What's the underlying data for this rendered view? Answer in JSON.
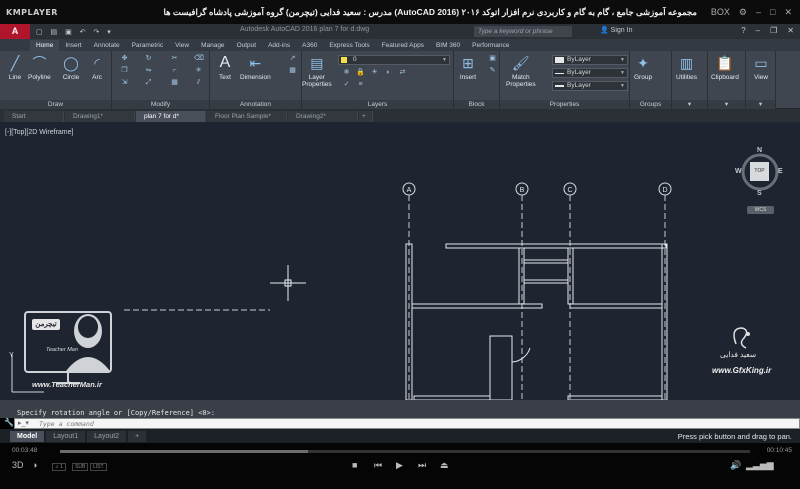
{
  "player": {
    "logo": "KMPLAYER",
    "title": "مجموعه آموزشی جامع ، گام به گام و کاربردی نرم افزار  اتوکد ۲۰۱۶ (AutoCAD 2016)  مدرس : سعید فدایی (تیچرمن) گروه آموزشی پادشاه گرافیست ها",
    "box_label": "BOX",
    "time_elapsed": "00:03:48",
    "time_total": "00:10:45",
    "progress": 0.36
  },
  "acad": {
    "logo": "A",
    "doc_title": "Autodesk AutoCAD 2016    plan 7 for d.dwg",
    "search_placeholder": "Type a keyword or phrase",
    "signin": "Sign In",
    "ribbon_tabs": [
      "Home",
      "Insert",
      "Annotate",
      "Parametric",
      "View",
      "Manage",
      "Output",
      "Add-ins",
      "A360",
      "Express Tools",
      "Featured Apps",
      "BIM 360",
      "Performance"
    ],
    "panels": {
      "draw": {
        "title": "Draw",
        "line": "Line",
        "polyline": "Polyline",
        "circle": "Circle",
        "arc": "Arc"
      },
      "modify": {
        "title": "Modify"
      },
      "annotation": {
        "title": "Annotation",
        "text": "Text",
        "dimension": "Dimension"
      },
      "layers": {
        "title": "Layers",
        "layer_properties": "Layer\nProperties",
        "current_layer": "0"
      },
      "block": {
        "title": "Block",
        "insert": "Insert"
      },
      "properties": {
        "title": "Properties",
        "match": "Match\nProperties",
        "color": "ByLayer",
        "linetype": "ByLayer",
        "lineweight": "ByLayer"
      },
      "groups": {
        "title": "Groups",
        "group": "Group"
      },
      "utilities": {
        "label": "Utilities"
      },
      "clipboard": {
        "label": "Clipboard"
      },
      "view": {
        "label": "View"
      }
    },
    "file_tabs": [
      "Start",
      "Drawing1*",
      "plan 7 for d*",
      "Floor Plan Sample*",
      "Drawing2*"
    ],
    "active_file_tab": 2,
    "viewport_label": "[-][Top][2D Wireframe]",
    "viewcube": {
      "n": "N",
      "s": "S",
      "e": "E",
      "w": "W",
      "top": "TOP",
      "wcs": "WCS"
    },
    "grid_labels": [
      "A",
      "B",
      "C",
      "D"
    ],
    "command_history": "Specify rotation angle or [Copy/Reference] <0>:",
    "command_placeholder": "Type a command",
    "layout_tabs": [
      "Model",
      "Layout1",
      "Layout2"
    ],
    "status_text": "Press pick button and drag to pan."
  },
  "watermarks": {
    "teacher_badge": "تیچرمن",
    "teacher_name": "Teacher Man",
    "teacher_url": "www.TeacherMan.ir",
    "gfx_name": "سعید فدایی",
    "gfx_url": "www.GfxKing.ir"
  }
}
